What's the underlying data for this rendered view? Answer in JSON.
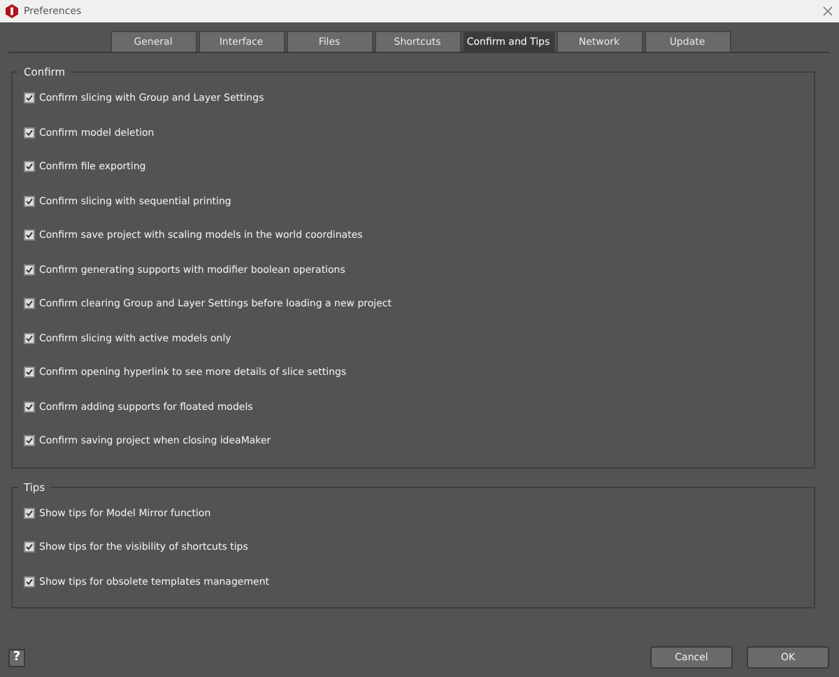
{
  "window": {
    "title": "Preferences"
  },
  "tabs": [
    {
      "label": "General",
      "selected": false
    },
    {
      "label": "Interface",
      "selected": false
    },
    {
      "label": "Files",
      "selected": false
    },
    {
      "label": "Shortcuts",
      "selected": false
    },
    {
      "label": "Confirm and Tips",
      "selected": true
    },
    {
      "label": "Network",
      "selected": false
    },
    {
      "label": "Update",
      "selected": false
    }
  ],
  "groups": [
    {
      "title": "Confirm",
      "items": [
        {
          "label": "Confirm slicing with Group and Layer Settings",
          "checked": true
        },
        {
          "label": "Confirm model deletion",
          "checked": true
        },
        {
          "label": "Confirm file exporting",
          "checked": true
        },
        {
          "label": "Confirm slicing with sequential printing",
          "checked": true
        },
        {
          "label": "Confirm save project with scaling models in the world coordinates",
          "checked": true
        },
        {
          "label": "Confirm generating supports with modifier boolean operations",
          "checked": true
        },
        {
          "label": "Confirm clearing Group and Layer Settings before loading a new project",
          "checked": true
        },
        {
          "label": "Confirm slicing with active models only",
          "checked": true
        },
        {
          "label": "Confirm opening hyperlink to see more details of slice settings",
          "checked": true
        },
        {
          "label": "Confirm adding supports for floated models",
          "checked": true
        },
        {
          "label": "Confirm saving project when closing ideaMaker",
          "checked": true
        }
      ]
    },
    {
      "title": "Tips",
      "items": [
        {
          "label": "Show tips for Model Mirror function",
          "checked": true
        },
        {
          "label": "Show tips for the visibility of shortcuts tips",
          "checked": true
        },
        {
          "label": "Show tips for obsolete templates management",
          "checked": true
        }
      ]
    }
  ],
  "help": "?",
  "buttons": [
    "Cancel",
    "OK"
  ]
}
